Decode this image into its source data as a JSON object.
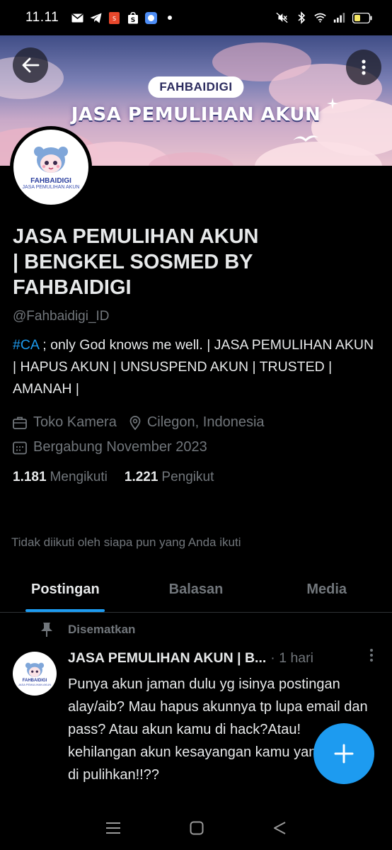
{
  "status_bar": {
    "time": "11.11",
    "battery_color": "#f5e663"
  },
  "banner": {
    "pill_text": "FAHBAIDIGI",
    "title": "JASA PEMULIHAN AKUN"
  },
  "avatar": {
    "line1": "FAHBAIDIGI",
    "line2": "JASA PEMULIHAN AKUN"
  },
  "profile": {
    "name_line1": "JASA PEMULIHAN AKUN",
    "name_line2": "| BENGKEL SOSMED BY",
    "name_line3": "FAHBAIDIGI",
    "handle": "@Fahbaidigi_ID",
    "bio_hashtag": "#CA",
    "bio_rest": " ; only God knows me well. | JASA PEMULIHAN AKUN | HAPUS AKUN | UNSUSPEND AKUN | TRUSTED | AMANAH |",
    "category": "Toko Kamera",
    "location": "Cilegon, Indonesia",
    "joined": "Bergabung November 2023",
    "following_count": "1.181",
    "following_label": "Mengikuti",
    "followers_count": "1.221",
    "followers_label": "Pengikut",
    "not_followed_text": "Tidak diikuti oleh siapa pun yang Anda ikuti"
  },
  "tabs": [
    {
      "label": "Postingan",
      "active": true
    },
    {
      "label": "Balasan",
      "active": false
    },
    {
      "label": "Media",
      "active": false
    }
  ],
  "pinned": {
    "label": "Disematkan"
  },
  "post": {
    "author": "JASA PEMULIHAN AKUN | B...",
    "time": "· 1 hari",
    "text": "Punya akun jaman dulu yg isinya postingan alay/aib? Mau hapus akunnya tp lupa email dan pass? Atau akun kamu di hack?Atau! kehilangan akun kesayangan kamu yang ingin di pulihkan!!??"
  },
  "colors": {
    "accent": "#1d9bf0",
    "muted": "#71767b",
    "text": "#e7e9ea",
    "background": "#000000"
  },
  "icons": [
    "back-arrow-icon",
    "more-vertical-icon",
    "briefcase-icon",
    "location-pin-icon",
    "calendar-icon",
    "pin-icon",
    "more-vertical-icon",
    "plus-icon",
    "menu-icon",
    "home-square-icon",
    "back-triangle-icon"
  ]
}
